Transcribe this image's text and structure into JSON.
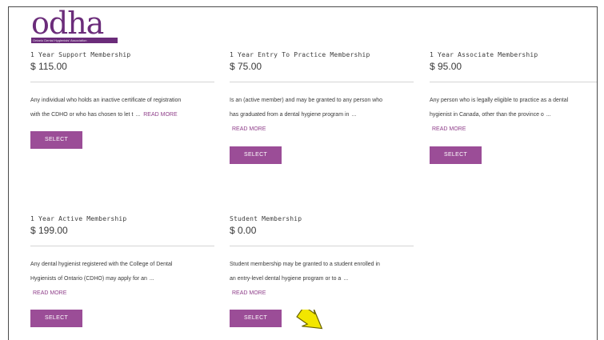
{
  "logo": {
    "word": "odha",
    "tagline": "Ontario Dental Hygienists' Association"
  },
  "memberships": [
    {
      "title": "1 Year Support Membership",
      "price": "$ 115.00",
      "desc1": "Any individual who holds an inactive certificate of registration",
      "desc2": "with the CDHO or who has chosen to let t",
      "ellipsis": "...",
      "read_more": "READ MORE",
      "select": "SELECT"
    },
    {
      "title": "1 Year Entry To Practice Membership",
      "price": "$ 75.00",
      "desc1": "Is an (active member) and may be granted to any person who",
      "desc2": "has graduated from a dental hygiene program in",
      "ellipsis": "...",
      "read_more": "READ MORE",
      "select": "SELECT"
    },
    {
      "title": "1 Year Associate Membership",
      "price": "$ 95.00",
      "desc1": "Any person who is legally eligible to practice as a dental",
      "desc2": "hygienist in Canada, other than the province o",
      "ellipsis": "...",
      "read_more": "READ MORE",
      "select": "SELECT"
    },
    {
      "title": "1 Year Active Membership",
      "price": "$ 199.00",
      "desc1": "Any dental hygienist registered with the College of Dental",
      "desc2": "Hygienists of Ontario (CDHO) may apply for an",
      "ellipsis": "...",
      "read_more": "READ MORE",
      "select": "SELECT"
    },
    {
      "title": "Student Membership",
      "price": "$ 0.00",
      "desc1": "Student membership may be granted to a student enrolled in",
      "desc2": "an entry-level dental hygiene program or to a",
      "ellipsis": "...",
      "read_more": "READ MORE",
      "select": "SELECT"
    }
  ],
  "colors": {
    "brand": "#6b2c7a",
    "button": "#9b4d97",
    "link": "#8f3f8a",
    "annotation_arrow": "#f2e600"
  },
  "annotation": {
    "icon": "pointer-arrow-icon"
  }
}
